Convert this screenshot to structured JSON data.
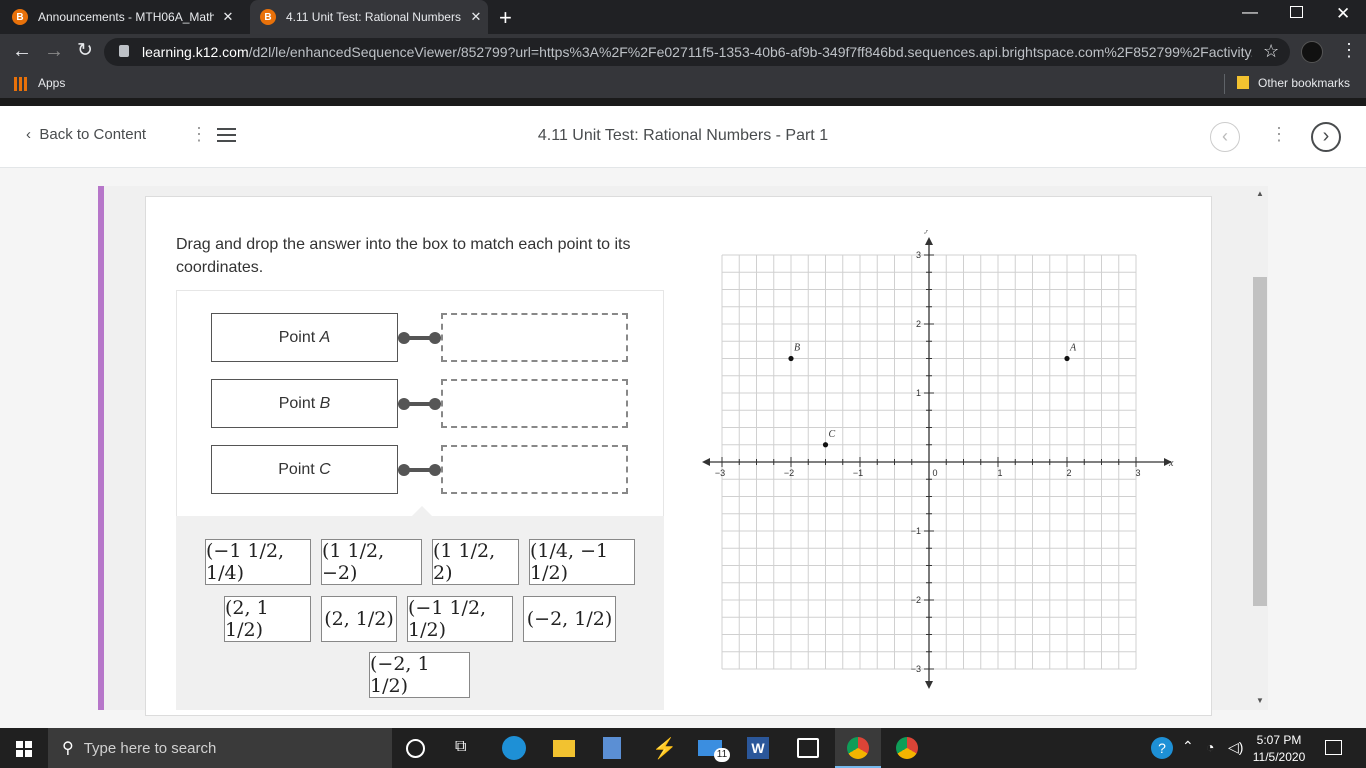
{
  "browser": {
    "tabs": [
      {
        "title": "Announcements - MTH06A_Math",
        "active": false
      },
      {
        "title": "4.11 Unit Test: Rational Numbers",
        "active": true
      }
    ],
    "url_domain": "learning.k12.com",
    "url_path": "/d2l/le/enhancedSequenceViewer/852799?url=https%3A%2F%2Fe02711f5-1353-40b6-af9b-349f7ff846bd.sequences.api.brightspace.com%2F852799%2Factivity...",
    "bookmarks": {
      "apps": "Apps",
      "other": "Other bookmarks"
    }
  },
  "header": {
    "back": "Back to Content",
    "title": "4.11 Unit Test: Rational Numbers - Part 1"
  },
  "question": {
    "prompt": "Drag and drop the answer into the box to match each point to its coordinates.",
    "points": [
      {
        "label": "Point",
        "letter": "A"
      },
      {
        "label": "Point",
        "letter": "B"
      },
      {
        "label": "Point",
        "letter": "C"
      }
    ],
    "answers": [
      "(−1 1/2, 1/4)",
      "(1 1/2, −2)",
      "(1 1/2, 2)",
      "(1/4, −1 1/2)",
      "(2, 1 1/2)",
      "(2, 1/2)",
      "(−1 1/2, 1/2)",
      "(−2, 1/2)",
      "(−2, 1 1/2)"
    ]
  },
  "graph": {
    "x_label": "x",
    "y_label": "y",
    "x_ticks": [
      "−3",
      "−2",
      "−1",
      "0",
      "1",
      "2",
      "3"
    ],
    "y_ticks": [
      "3",
      "2",
      "1",
      "−1",
      "−2",
      "−3"
    ],
    "points": [
      {
        "name": "A",
        "x": 2,
        "y": 1.5
      },
      {
        "name": "B",
        "x": -2,
        "y": 1.5
      },
      {
        "name": "C",
        "x": -1.5,
        "y": 0.25
      }
    ]
  },
  "taskbar": {
    "search": "Type here to search",
    "time": "5:07 PM",
    "date": "11/5/2020",
    "mail_badge": "11"
  }
}
